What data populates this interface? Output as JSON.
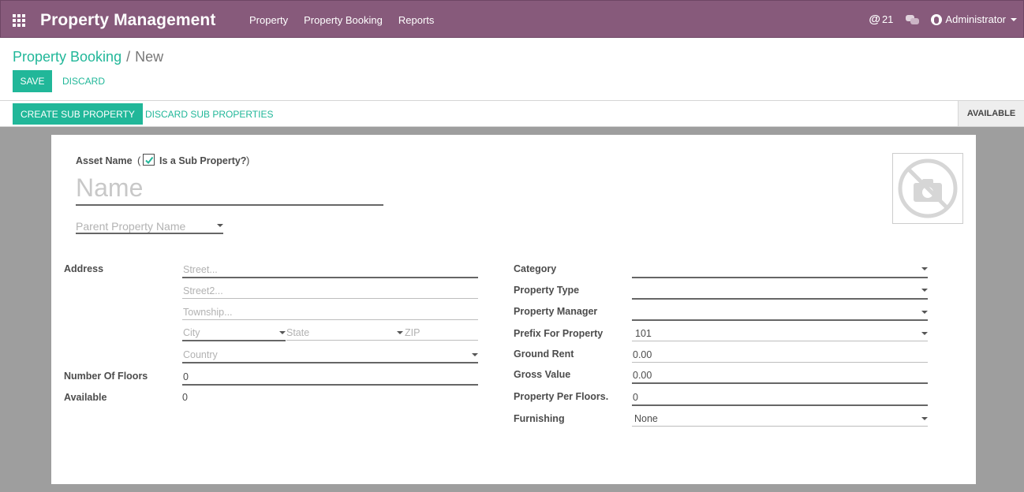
{
  "navbar": {
    "brand": "Property Management",
    "menu": [
      "Property",
      "Property Booking",
      "Reports"
    ],
    "mention_count": "21",
    "user_name": "Administrator"
  },
  "breadcrumb": {
    "parent": "Property Booking",
    "separator": "/",
    "current": "New"
  },
  "buttons": {
    "save": "SAVE",
    "discard": "DISCARD"
  },
  "statusbar": {
    "create_sub": "CREATE SUB PROPERTY",
    "discard_sub": "DISCARD SUB PROPERTIES",
    "status": "AVAILABLE"
  },
  "form": {
    "asset_name_label": "Asset Name",
    "paren_open": "(",
    "paren_close": ")",
    "is_sub_property_label": "Is a Sub Property?",
    "is_sub_property_checked": true,
    "name_placeholder": "Name",
    "parent_placeholder": "Parent Property Name",
    "address_label": "Address",
    "street_placeholder": "Street...",
    "street2_placeholder": "Street2...",
    "township_placeholder": "Township...",
    "city_placeholder": "City",
    "state_placeholder": "State",
    "zip_placeholder": "ZIP",
    "country_placeholder": "Country",
    "floors_label": "Number Of Floors",
    "floors_value": "0",
    "available_label": "Available",
    "available_value": "0",
    "category_label": "Category",
    "property_type_label": "Property Type",
    "property_manager_label": "Property Manager",
    "prefix_label": "Prefix For Property",
    "prefix_value": "101",
    "ground_rent_label": "Ground Rent",
    "ground_rent_value": "0.00",
    "gross_value_label": "Gross Value",
    "gross_value_value": "0.00",
    "per_floor_label": "Property Per Floors.",
    "per_floor_value": "0",
    "furnishing_label": "Furnishing",
    "furnishing_value": "None"
  },
  "colors": {
    "navbar": "#875a7b",
    "accent": "#21b799",
    "background": "#9e9e9e"
  },
  "icons": [
    "apps-grid-icon",
    "chat-icon",
    "user-avatar-icon",
    "no-camera-icon",
    "checkmark-icon"
  ]
}
